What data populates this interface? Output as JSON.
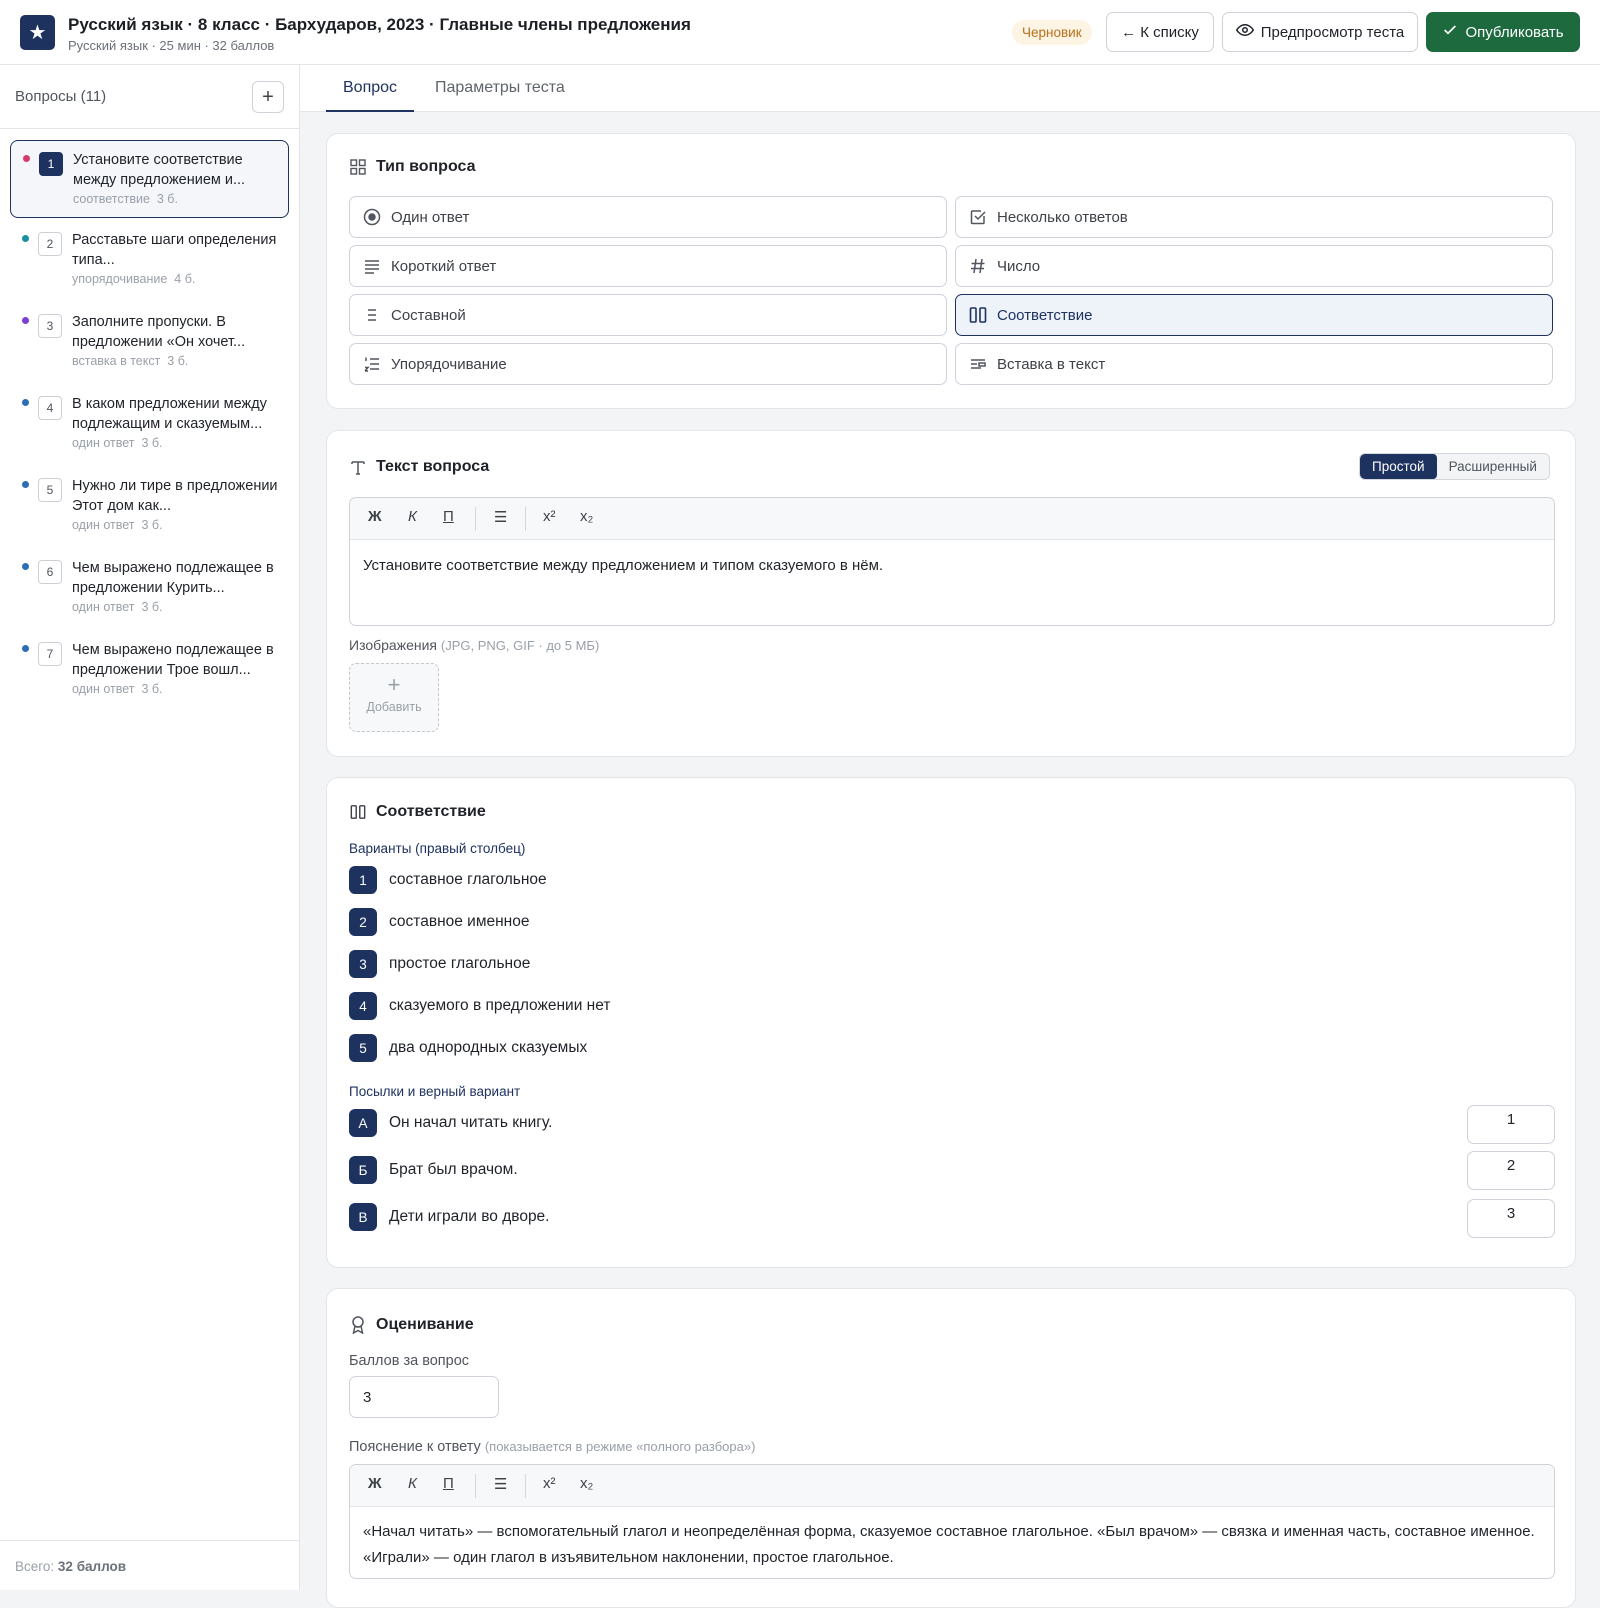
{
  "header": {
    "title": "Русский язык · 8 класс · Бархударов, 2023 · Главные члены предложения",
    "subtitle": "Русский язык · 25 мин · 32 баллов",
    "status": "Черновик",
    "back_label": "← К списку",
    "preview_label": "Предпросмотр теста",
    "publish_label": "Опубликовать",
    "accent": "#1e3260",
    "publish_color": "#1c6a3d"
  },
  "sidebar": {
    "title": "Вопросы (11)",
    "add_label": "+",
    "total_prefix": "Всего:",
    "total_value": "32 баллов",
    "items": [
      {
        "num": "1",
        "text": "Установите соответствие между предложением и...",
        "type": "соответствие",
        "points": "3 б.",
        "color": "#d63a6b"
      },
      {
        "num": "2",
        "text": "Расставьте шаги определения типа...",
        "type": "упорядочивание",
        "points": "4 б.",
        "color": "#1a8fa0"
      },
      {
        "num": "3",
        "text": "Заполните пропуски. В предложении «Он хочет...",
        "type": "вставка в текст",
        "points": "3 б.",
        "color": "#7b3fd6"
      },
      {
        "num": "4",
        "text": "В каком предложении между подлежащим и сказуемым...",
        "type": "один ответ",
        "points": "3 б.",
        "color": "#2c6db5"
      },
      {
        "num": "5",
        "text": "Нужно ли тире в предложении Этот дом как...",
        "type": "один ответ",
        "points": "3 б.",
        "color": "#2c6db5"
      },
      {
        "num": "6",
        "text": "Чем выражено подлежащее в предложении Курить...",
        "type": "один ответ",
        "points": "3 б.",
        "color": "#2c6db5"
      },
      {
        "num": "7",
        "text": "Чем выражено подлежащее в предложении Трое вошл...",
        "type": "один ответ",
        "points": "3 б.",
        "color": "#2c6db5"
      }
    ]
  },
  "tabs": [
    {
      "label": "Вопрос"
    },
    {
      "label": "Параметры теста"
    }
  ],
  "question_type": {
    "title": "Тип вопроса",
    "options": [
      {
        "label": "Один ответ",
        "icon": "radio-icon"
      },
      {
        "label": "Несколько ответов",
        "icon": "checkbox-icon"
      },
      {
        "label": "Короткий ответ",
        "icon": "short-text-icon"
      },
      {
        "label": "Число",
        "icon": "hash-icon"
      },
      {
        "label": "Составной",
        "icon": "list-icon"
      },
      {
        "label": "Соответствие",
        "icon": "columns-icon"
      },
      {
        "label": "Упорядочивание",
        "icon": "ordered-list-icon"
      },
      {
        "label": "Вставка в текст",
        "icon": "insert-text-icon"
      }
    ],
    "selected": "Соответствие"
  },
  "question_text": {
    "title": "Текст вопроса",
    "mode_simple": "Простой",
    "mode_advanced": "Расширенный",
    "toolbar": {
      "bold": "Ж",
      "italic": "К",
      "underline": "П",
      "list": "☰",
      "sup": "x²",
      "sub": "x₂"
    },
    "body": "Установите соответствие между предложением и типом сказуемого в нём.",
    "images_label": "Изображения",
    "images_hint": "(JPG, PNG, GIF · до 5 МБ)",
    "add_image": "Добавить"
  },
  "matching": {
    "title": "Соответствие",
    "variants_label": "Варианты (правый столбец)",
    "variants": [
      {
        "num": "1",
        "text": "составное глагольное"
      },
      {
        "num": "2",
        "text": "составное именное"
      },
      {
        "num": "3",
        "text": "простое глагольное"
      },
      {
        "num": "4",
        "text": "сказуемого в предложении нет"
      },
      {
        "num": "5",
        "text": "два однородных сказуемых"
      }
    ],
    "premises_label": "Посылки и верный вариант",
    "premises": [
      {
        "letter": "А",
        "text": "Он начал читать книгу.",
        "answer": "1"
      },
      {
        "letter": "Б",
        "text": "Брат был врачом.",
        "answer": "2"
      },
      {
        "letter": "В",
        "text": "Дети играли во дворе.",
        "answer": "3"
      }
    ]
  },
  "grading": {
    "title": "Оценивание",
    "points_label": "Баллов за вопрос",
    "points_value": "3",
    "explanation_label": "Пояснение к ответу",
    "explanation_hint": "(показывается в режиме «полного разбора»)",
    "explanation": "«Начал читать» — вспомогательный глагол и неопределённая форма, сказуемое составное глагольное. «Был врачом» — связка и именная часть, составное именное. «Играли» — один глагол в изъявительном наклонении, простое глагольное."
  }
}
